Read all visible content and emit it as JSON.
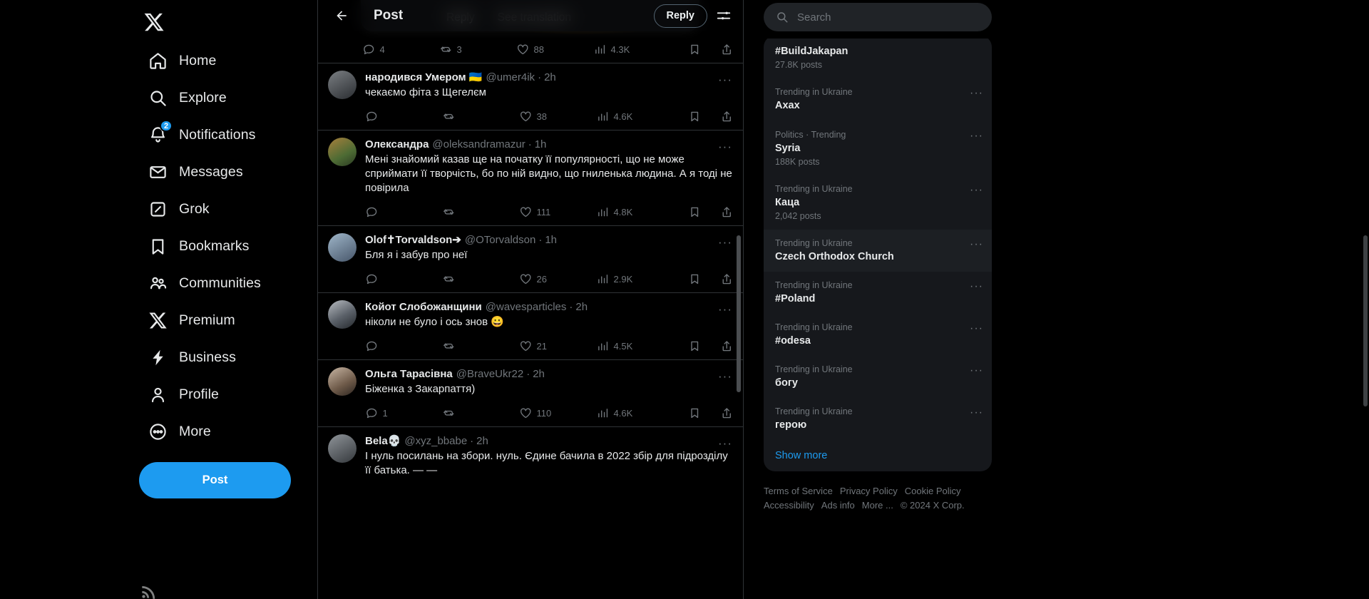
{
  "sidebar": {
    "logo": "x-logo",
    "items": [
      {
        "label": "Home",
        "icon": "home-icon"
      },
      {
        "label": "Explore",
        "icon": "search-icon"
      },
      {
        "label": "Notifications",
        "icon": "bell-icon",
        "badge": "2"
      },
      {
        "label": "Messages",
        "icon": "mail-icon"
      },
      {
        "label": "Grok",
        "icon": "grok-icon"
      },
      {
        "label": "Bookmarks",
        "icon": "bookmark-icon"
      },
      {
        "label": "Communities",
        "icon": "communities-icon"
      },
      {
        "label": "Premium",
        "icon": "x-logo-icon"
      },
      {
        "label": "Business",
        "icon": "bolt-icon"
      },
      {
        "label": "Profile",
        "icon": "person-icon"
      },
      {
        "label": "More",
        "icon": "more-circle-icon"
      }
    ],
    "post_button": "Post"
  },
  "header": {
    "title": "Post",
    "back_icon": "arrow-left-icon",
    "reply_button": "Reply",
    "settings_icon": "sliders-icon"
  },
  "hover_card": {
    "reply": "Reply",
    "see_translation": "See translation"
  },
  "partial_tweet_actions": {
    "replies": "4",
    "reposts": "3",
    "likes": "88",
    "views": "4.3K"
  },
  "tweets": [
    {
      "name": "народився Умером 🇺🇦",
      "handle": "@umer4ik",
      "time": "2h",
      "text": "чекаємо фіта з Щегелєм",
      "replies": "",
      "reposts": "",
      "likes": "38",
      "views": "4.6K",
      "avatar_class": "gradav1"
    },
    {
      "name": "Олександра",
      "handle": "@oleksandramazur",
      "time": "1h",
      "text": "Мені знайомий казав ще на початку її популярності, що не може сприймати її творчість, бо по ній видно, що гниленька людина. А я тоді не повірила",
      "replies": "",
      "reposts": "",
      "likes": "111",
      "views": "4.8K",
      "avatar_class": "gradav2"
    },
    {
      "name": "Olof✝Torvaldson➔",
      "handle": "@OTorvaldson",
      "time": "1h",
      "text": "Бля я і забув про неї",
      "replies": "",
      "reposts": "",
      "likes": "26",
      "views": "2.9K",
      "avatar_class": "gradav3"
    },
    {
      "name": "Койот Слобожанщини",
      "handle": "@wavesparticles",
      "time": "2h",
      "text": "ніколи не було і ось знов 😀",
      "replies": "",
      "reposts": "",
      "likes": "21",
      "views": "4.5K",
      "avatar_class": "gradav4"
    },
    {
      "name": "Ольга Тарасівна",
      "handle": "@BraveUkr22",
      "time": "2h",
      "text": "Біженка з Закарпаття)",
      "replies": "1",
      "reposts": "",
      "likes": "110",
      "views": "4.6K",
      "avatar_class": "gradav5"
    },
    {
      "name": "Bela💀",
      "handle": "@xyz_bbabe",
      "time": "2h",
      "text": "І нуль посилань на збори. нуль. Єдине бачила в 2022 збір для підрозділу її батька. — —",
      "replies": "",
      "reposts": "",
      "likes": "",
      "views": "",
      "avatar_class": "gradav6"
    }
  ],
  "search": {
    "placeholder": "Search",
    "value": "",
    "icon": "search-icon"
  },
  "trending": {
    "items": [
      {
        "category": "",
        "name": "#BuildJakapan",
        "count": "27.8K posts",
        "highlight": false
      },
      {
        "category": "Trending in Ukraine",
        "name": "Axax",
        "count": "",
        "highlight": false
      },
      {
        "category": "Politics · Trending",
        "name": "Syria",
        "count": "188K posts",
        "highlight": false
      },
      {
        "category": "Trending in Ukraine",
        "name": "Каца",
        "count": "2,042 posts",
        "highlight": false
      },
      {
        "category": "Trending in Ukraine",
        "name": "Czech Orthodox Church",
        "count": "",
        "highlight": true
      },
      {
        "category": "Trending in Ukraine",
        "name": "#Poland",
        "count": "",
        "highlight": false
      },
      {
        "category": "Trending in Ukraine",
        "name": "#odesa",
        "count": "",
        "highlight": false
      },
      {
        "category": "Trending in Ukraine",
        "name": "богу",
        "count": "",
        "highlight": false
      },
      {
        "category": "Trending in Ukraine",
        "name": "герою",
        "count": "",
        "highlight": false
      }
    ],
    "show_more": "Show more"
  },
  "footer": {
    "line1": [
      "Terms of Service",
      "Privacy Policy",
      "Cookie Policy"
    ],
    "line2": [
      "Accessibility",
      "Ads info",
      "More ..."
    ],
    "copyright": "© 2024 X Corp."
  },
  "colors": {
    "accent": "#1d9bf0",
    "background": "#000000",
    "card": "#16181c",
    "border": "#2f3336",
    "muted": "#71767b"
  }
}
